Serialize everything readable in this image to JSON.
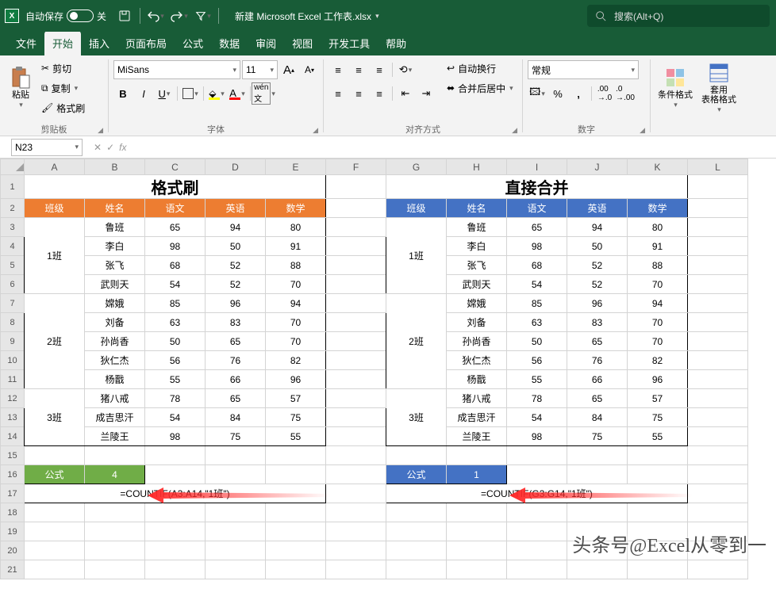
{
  "titlebar": {
    "autosave_label": "自动保存",
    "autosave_state": "关",
    "doc_title": "新建 Microsoft Excel 工作表.xlsx"
  },
  "search": {
    "placeholder": "搜索(Alt+Q)"
  },
  "menu": {
    "file": "文件",
    "home": "开始",
    "insert": "插入",
    "layout": "页面布局",
    "formulas": "公式",
    "data": "数据",
    "review": "审阅",
    "view": "视图",
    "dev": "开发工具",
    "help": "帮助"
  },
  "ribbon": {
    "paste": "粘贴",
    "cut": "剪切",
    "copy": "复制",
    "painter": "格式刷",
    "clipboard_group": "剪贴板",
    "font_group": "字体",
    "font_name": "MiSans",
    "font_size": "11",
    "align_group": "对齐方式",
    "wrap": "自动换行",
    "merge": "合并后居中",
    "number_group": "数字",
    "num_format": "常规",
    "cond_fmt": "条件格式",
    "as_table": "套用\n表格格式"
  },
  "namebox": "N23",
  "sheet": {
    "title_left": "格式刷",
    "title_right": "直接合并",
    "hdr": {
      "class": "班级",
      "name": "姓名",
      "chinese": "语文",
      "english": "英语",
      "math": "数学"
    },
    "classes": {
      "c1": "1班",
      "c2": "2班",
      "c3": "3班"
    },
    "rows": [
      {
        "name": "鲁班",
        "c": 65,
        "e": 94,
        "m": 80
      },
      {
        "name": "李白",
        "c": 98,
        "e": 50,
        "m": 91
      },
      {
        "name": "张飞",
        "c": 68,
        "e": 52,
        "m": 88
      },
      {
        "name": "武则天",
        "c": 54,
        "e": 52,
        "m": 70
      },
      {
        "name": "嫦娥",
        "c": 85,
        "e": 96,
        "m": 94
      },
      {
        "name": "刘备",
        "c": 63,
        "e": 83,
        "m": 70
      },
      {
        "name": "孙尚香",
        "c": 50,
        "e": 65,
        "m": 70
      },
      {
        "name": "狄仁杰",
        "c": 56,
        "e": 76,
        "m": 82
      },
      {
        "name": "杨戬",
        "c": 55,
        "e": 66,
        "m": 96
      },
      {
        "name": "猪八戒",
        "c": 78,
        "e": 65,
        "m": 57
      },
      {
        "name": "成吉思汗",
        "c": 54,
        "e": 84,
        "m": 75
      },
      {
        "name": "兰陵王",
        "c": 98,
        "e": 75,
        "m": 55
      }
    ],
    "formula_label": "公式",
    "result_left": "4",
    "result_right": "1",
    "formula_left": "=COUNTIF(A3:A14,\"1班\")",
    "formula_right": "=COUNTIF(G3:G14,\"1班\")"
  },
  "watermark": "头条号@Excel从零到一",
  "cols": [
    "A",
    "B",
    "C",
    "D",
    "E",
    "F",
    "G",
    "H",
    "I",
    "J",
    "K",
    "L"
  ]
}
